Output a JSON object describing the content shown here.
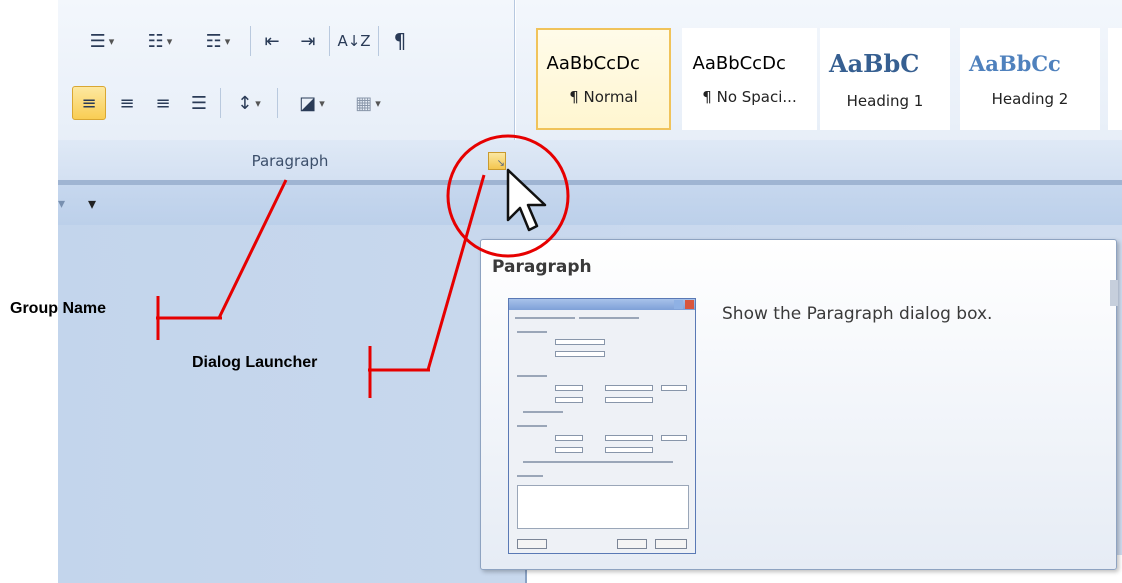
{
  "ribbon": {
    "paragraph_group": {
      "label": "Paragraph",
      "row1": [
        "bullets",
        "numbering",
        "multilevel-list",
        "decrease-indent",
        "increase-indent",
        "sort",
        "show-hide"
      ],
      "row2": [
        "align-left",
        "center",
        "align-right",
        "justify",
        "line-spacing",
        "shading",
        "borders"
      ],
      "sort_glyph": "A↓Z",
      "pilcrow": "¶"
    },
    "styles": [
      {
        "sample": "AaBbCcDc",
        "name": "¶ Normal",
        "selected": true
      },
      {
        "sample": "AaBbCcDc",
        "name": "¶ No Spaci...",
        "selected": false
      },
      {
        "sample": "AaBbC",
        "name": "Heading 1",
        "selected": false
      },
      {
        "sample": "AaBbCc",
        "name": "Heading 2",
        "selected": false
      }
    ]
  },
  "tooltip": {
    "title": "Paragraph",
    "description": "Show the Paragraph dialog box."
  },
  "annotations": {
    "group_name": "Group Name",
    "dialog_launcher": "Dialog Launcher",
    "line_color": "#e60000"
  },
  "colors": {
    "ribbon_bg": "#e4ecf7",
    "selected_button": "#f9cd53",
    "annotation_red": "#e60000"
  }
}
